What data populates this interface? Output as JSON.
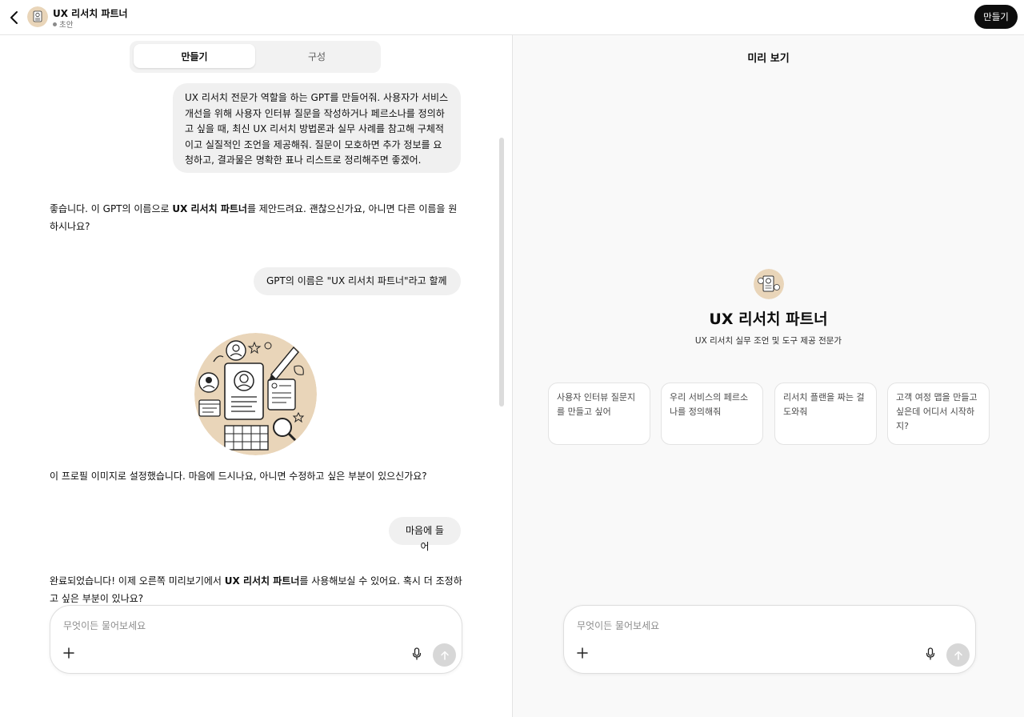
{
  "header": {
    "title": "UX 리서치 파트너",
    "status": "초안",
    "create_button": "만들기"
  },
  "tabs": [
    {
      "label": "만들기",
      "active": true
    },
    {
      "label": "구성",
      "active": false
    }
  ],
  "chat": {
    "user_msg_1": "UX 리서치 전문가 역할을 하는 GPT를 만들어줘. 사용자가 서비스 개선을 위해 사용자 인터뷰 질문을 작성하거나 페르소나를 정의하고 싶을 때, 최신 UX 리서치 방법론과 실무 사례를 참고해 구체적이고 실질적인 조언을 제공해줘. 질문이 모호하면 추가 정보를 요청하고, 결과물은 명확한 표나 리스트로 정리해주면 좋겠어.",
    "assistant_msg_1": {
      "before": "좋습니다. 이 GPT의 이름으로 ",
      "bold": "UX 리서치 파트너",
      "after": "를 제안드려요. 괜찮으신가요, 아니면 다른 이름을 원하시나요?"
    },
    "user_msg_2": "GPT의 이름은 \"UX 리서치 파트너\"라고 할께",
    "assistant_msg_2": "이 프로필 이미지로 설정했습니다. 마음에 드시나요, 아니면 수정하고 싶은 부분이 있으신가요?",
    "user_msg_3": "마음에 들어",
    "assistant_msg_3": {
      "before": "완료되었습니다! 이제 오른쪽 미리보기에서 ",
      "bold": "UX 리서치 파트너",
      "after": "를 사용해보실 수 있어요. 혹시 더 조정하고 싶은 부분이 있나요?"
    },
    "composer_placeholder": "무엇이든 물어보세요"
  },
  "preview": {
    "title": "미리 보기",
    "gpt_name": "UX 리서치 파트너",
    "gpt_description": "UX 리서치 실무 조언 및 도구 제공 전문가",
    "starters": [
      "사용자 인터뷰 질문지를 만들고 싶어",
      "우리 서비스의 페르소나를 정의해줘",
      "리서치 플랜을 짜는 걸 도와줘",
      "고객 여정 맵을 만들고 싶은데 어디서 시작하지?"
    ],
    "composer_placeholder": "무엇이든 물어보세요"
  },
  "icons": {
    "back": "chevron-left-icon",
    "plus": "plus-icon",
    "mic": "microphone-icon",
    "send": "arrow-up-icon",
    "scroll": "arrow-down-icon"
  },
  "colors": {
    "accent_dark": "#0d0d0d",
    "bubble_bg": "#f0f0f0",
    "preview_bg": "#f9f9f9",
    "avatar_bg": "#e9d5b9"
  }
}
